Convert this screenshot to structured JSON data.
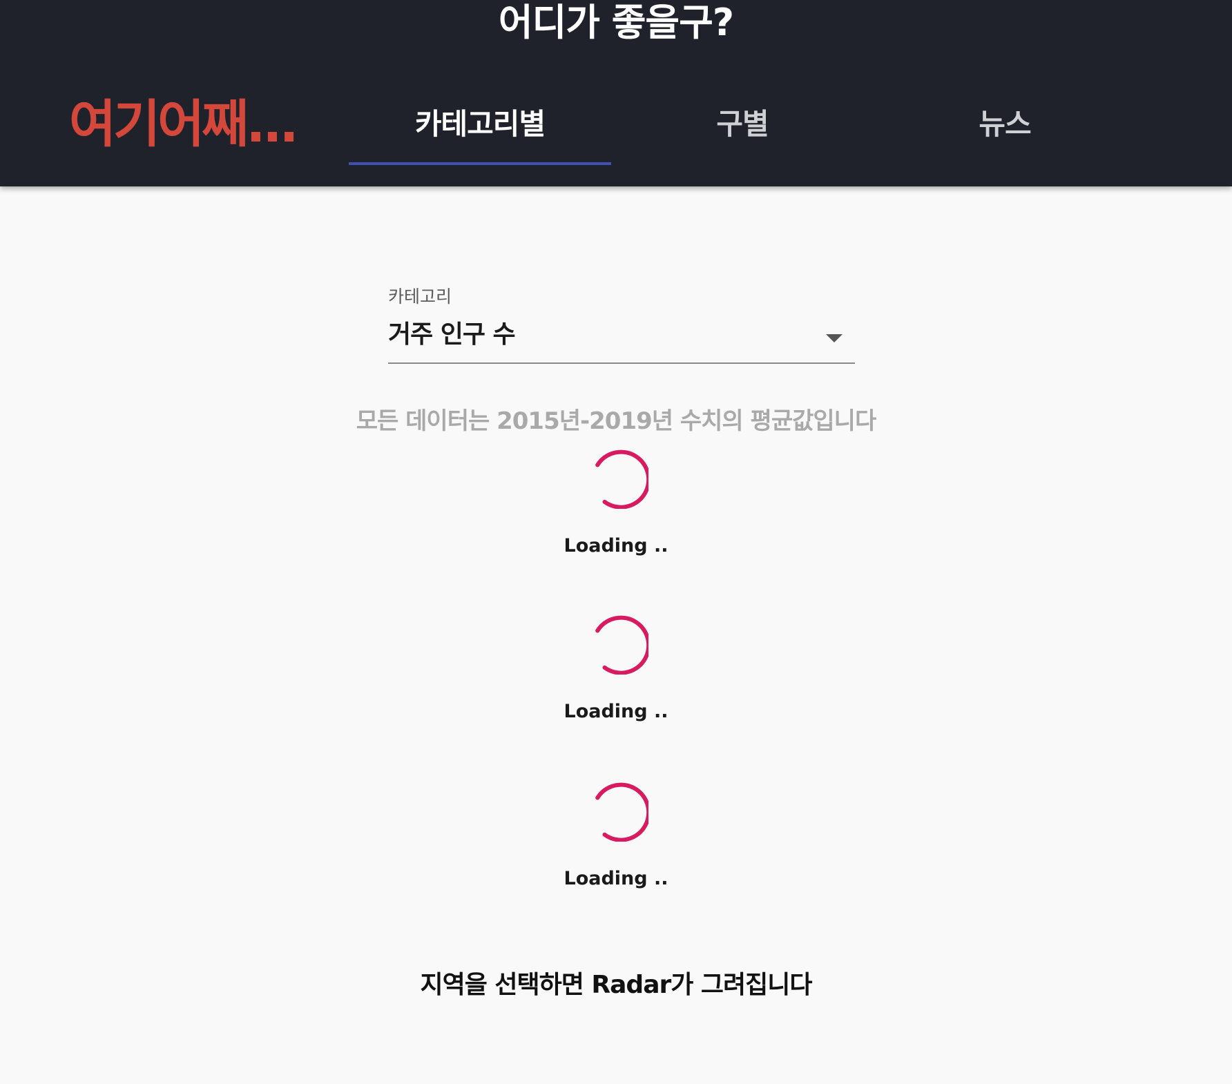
{
  "header": {
    "app_title": "어디가 좋을구?",
    "logo_text": "여기어째...",
    "tabs": [
      {
        "label": "카테고리별",
        "active": true
      },
      {
        "label": "구별",
        "active": false
      },
      {
        "label": "뉴스",
        "active": false
      }
    ],
    "background_color": "#20222b",
    "logo_color": "#d4483c",
    "indicator_color": "#3f51b5"
  },
  "category_select": {
    "label": "카테고리",
    "value": "거주 인구 수",
    "icon": "dropdown-arrow-icon"
  },
  "notice": "모든 데이터는 2015년-2019년 수치의 평균값입니다",
  "loaders": [
    {
      "text": "Loading .."
    },
    {
      "text": "Loading .."
    },
    {
      "text": "Loading .."
    }
  ],
  "spinner_color": "#d81b60",
  "radar_note": "지역을 선택하면 Radar가 그려집니다"
}
